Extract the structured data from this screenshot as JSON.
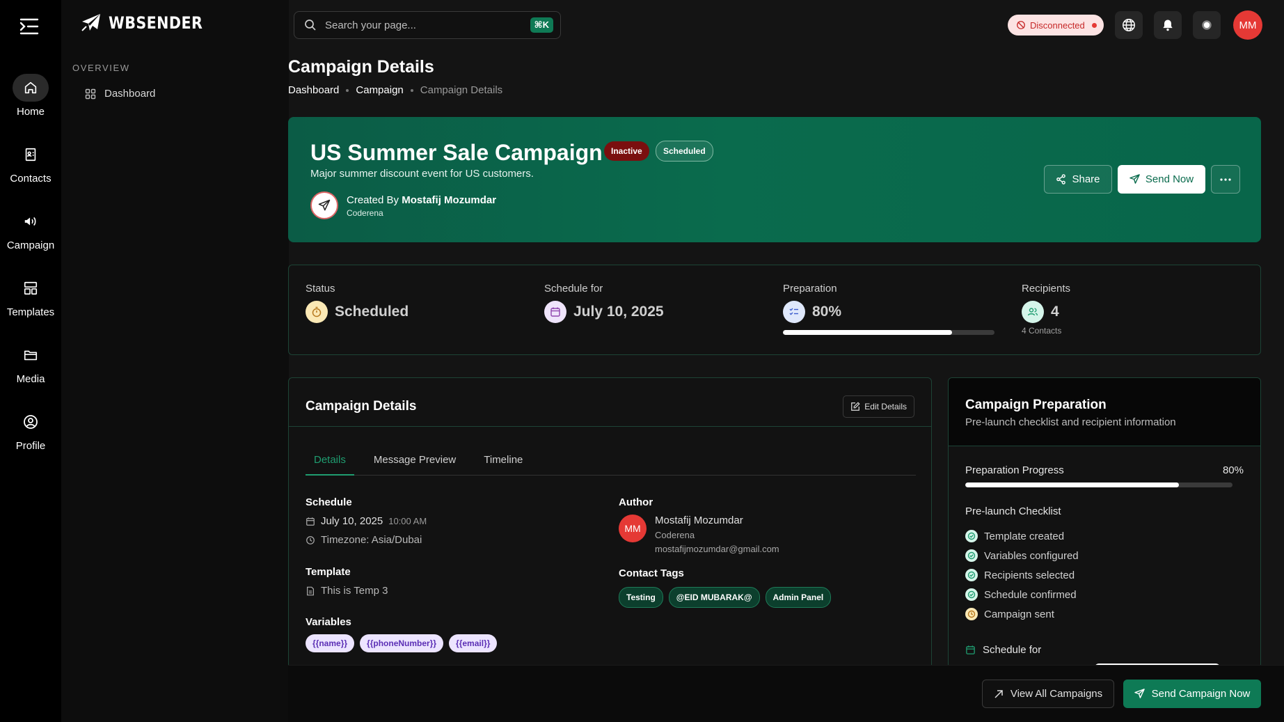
{
  "brand": {
    "name": "WBSENDER"
  },
  "rail": {
    "items": [
      {
        "label": "Home",
        "icon": "home-icon"
      },
      {
        "label": "Contacts",
        "icon": "contacts-icon"
      },
      {
        "label": "Campaign",
        "icon": "megaphone-icon"
      },
      {
        "label": "Templates",
        "icon": "templates-icon"
      },
      {
        "label": "Media",
        "icon": "folder-icon"
      },
      {
        "label": "Profile",
        "icon": "profile-icon"
      }
    ]
  },
  "nav": {
    "section": "OVERVIEW",
    "items": [
      {
        "label": "Dashboard",
        "icon": "grid-icon"
      }
    ]
  },
  "header": {
    "search_placeholder": "Search your page...",
    "search_shortcut": "⌘K",
    "connection_status": "Disconnected",
    "avatar_initials": "MM"
  },
  "page": {
    "title": "Campaign Details",
    "breadcrumbs": [
      "Dashboard",
      "Campaign",
      "Campaign Details"
    ]
  },
  "hero": {
    "title": "US Summer Sale Campaign",
    "badge_status": "Inactive",
    "badge_schedule": "Scheduled",
    "description": "Major summer discount event for US customers.",
    "created_by_prefix": "Created By",
    "created_by_name": "Mostafij Mozumdar",
    "organization": "Coderena",
    "share_label": "Share",
    "send_now_label": "Send Now"
  },
  "stats": {
    "status": {
      "label": "Status",
      "value": "Scheduled"
    },
    "schedule": {
      "label": "Schedule for",
      "value": "July 10, 2025"
    },
    "preparation": {
      "label": "Preparation",
      "value": "80%",
      "progress": 0.8
    },
    "recipients": {
      "label": "Recipients",
      "value": "4",
      "sub": "4 Contacts"
    }
  },
  "details": {
    "title": "Campaign Details",
    "edit_label": "Edit Details",
    "tabs": [
      "Details",
      "Message Preview",
      "Timeline"
    ],
    "schedule_heading": "Schedule",
    "schedule_date": "July 10, 2025",
    "schedule_time": "10:00 AM",
    "timezone": "Timezone: Asia/Dubai",
    "template_heading": "Template",
    "template_name": "This is Temp 3",
    "variables_heading": "Variables",
    "variables": [
      "{{name}}",
      "{{phoneNumber}}",
      "{{email}}"
    ],
    "author_heading": "Author",
    "author_initials": "MM",
    "author_name": "Mostafij Mozumdar",
    "author_org": "Coderena",
    "author_email": "mostafijmozumdar@gmail.com",
    "tags_heading": "Contact Tags",
    "tags": [
      "Testing",
      "@EID MUBARAK@",
      "Admin Panel"
    ]
  },
  "preparation_card": {
    "title": "Campaign Preparation",
    "subtitle": "Pre-launch checklist and recipient information",
    "progress_label": "Preparation Progress",
    "progress_value": "80%",
    "progress": 0.8,
    "checklist_heading": "Pre-launch Checklist",
    "checklist": [
      {
        "label": "Template created",
        "done": true
      },
      {
        "label": "Variables configured",
        "done": true
      },
      {
        "label": "Recipients selected",
        "done": true
      },
      {
        "label": "Schedule confirmed",
        "done": true
      },
      {
        "label": "Campaign sent",
        "done": false
      }
    ],
    "schedule_for_label": "Schedule for"
  },
  "footer": {
    "view_all_label": "View All Campaigns",
    "send_campaign_label": "Send Campaign Now"
  },
  "colors": {
    "accent": "#0e7a55",
    "hero_bg": "#0a6b4d",
    "inactive_badge": "#7a0f0f",
    "danger": "#e53935",
    "variable_chip_bg": "#ece4ff",
    "variable_chip_text": "#5b2fb5"
  }
}
